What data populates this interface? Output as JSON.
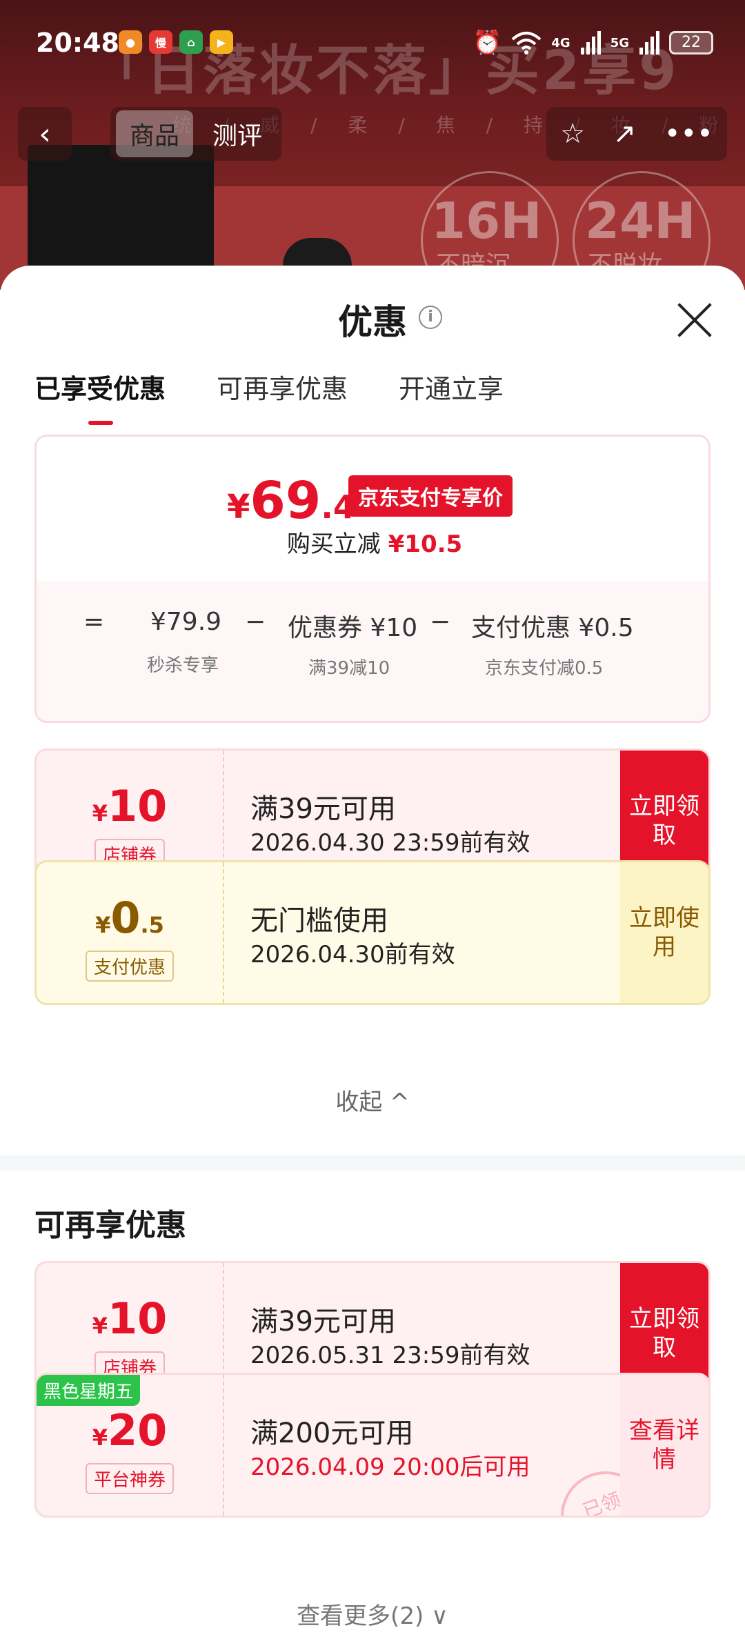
{
  "status_bar": {
    "time": "20:48",
    "battery": "22",
    "signal_4g": "4G",
    "signal_5g": "5G",
    "app_badge": "慢"
  },
  "background": {
    "banner": "「日落妆不落」买2享9",
    "subline": "统 / 威 / 柔 / 焦 / 持 / 妆 / 粉 / 底 / 液",
    "claim1_big": "16H",
    "claim1_small": "不暗沉",
    "claim2_big": "24H",
    "claim2_small": "不脱妆"
  },
  "nav": {
    "tabs": [
      "商品",
      "测评"
    ]
  },
  "sheet": {
    "title": "优惠",
    "tabs": [
      "已享受优惠",
      "可再享优惠",
      "开通立享"
    ],
    "summary": {
      "currency": "¥",
      "price_int": "69",
      "price_dec": ".4",
      "pay_tag": "京东支付专享价",
      "reduce_label": "购买立减",
      "reduce_value": "¥10.5",
      "eq": "=",
      "minus": "−",
      "base_price": "¥79.9",
      "base_sub": "秒杀专享",
      "coupon_price": "优惠券 ¥10",
      "coupon_sub": "满39减10",
      "pay_price": "支付优惠 ¥0.5",
      "pay_sub": "京东支付减0.5"
    },
    "applied_coupons": [
      {
        "currency": "¥",
        "amount": "10",
        "dec": "",
        "type": "店铺券",
        "condition": "满39元可用",
        "validity": "2026.04.30 23:59前有效",
        "action": "立即领取"
      },
      {
        "currency": "¥",
        "amount": "0",
        "dec": ".5",
        "type": "支付优惠",
        "condition": "无门槛使用",
        "validity": "2026.04.30前有效",
        "action": "立即使用"
      }
    ],
    "collapse_label": "收起 ^",
    "section_title": "可再享优惠",
    "more_coupons": [
      {
        "currency": "¥",
        "amount": "10",
        "type": "店铺券",
        "condition": "满39元可用",
        "validity": "2026.05.31 23:59前有效",
        "action": "立即领取"
      },
      {
        "badge": "黑色星期五",
        "currency": "¥",
        "amount": "20",
        "type": "平台神券",
        "condition": "满200元可用",
        "validity": "2026.04.09 20:00后可用",
        "action": "查看详情",
        "stamp": "已领"
      }
    ],
    "more_label": "查看更多(2) ∨"
  },
  "colors": {
    "accent": "#e4132a",
    "gold": "#8a5a00"
  }
}
